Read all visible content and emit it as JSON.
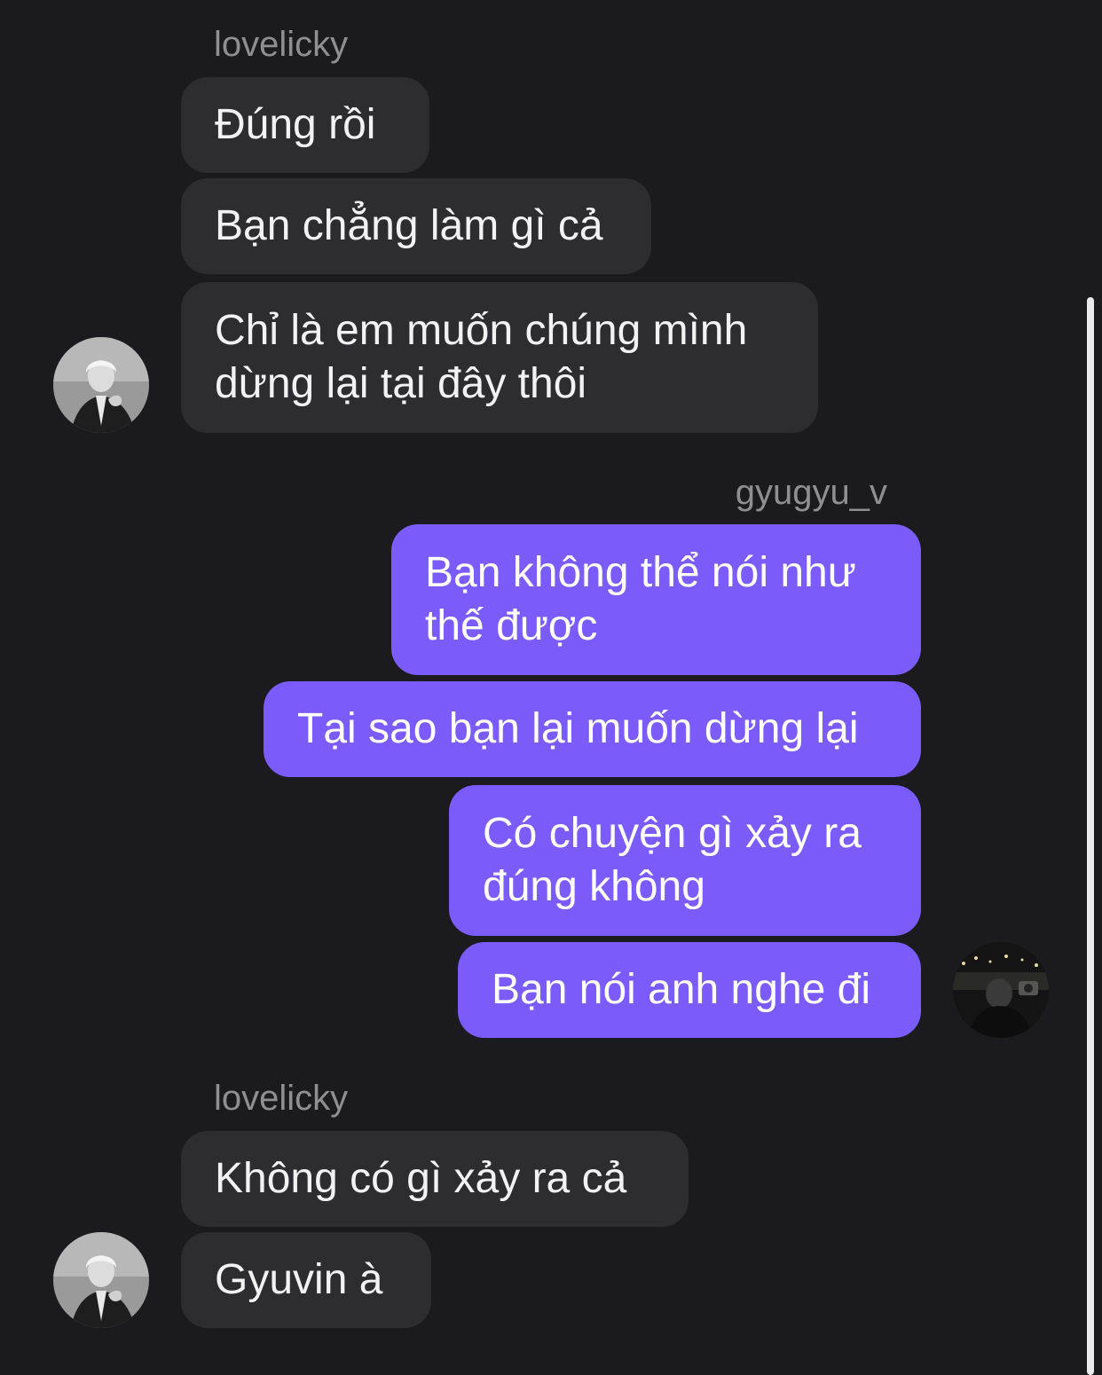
{
  "thread": {
    "group1": {
      "sender": "lovelicky",
      "messages": [
        "Đúng rồi",
        "Bạn chẳng làm gì cả",
        [
          "Chỉ là em muốn chúng mình",
          "dừng lại tại đây thôi"
        ]
      ]
    },
    "group2": {
      "sender": "gyugyu_v",
      "messages": [
        [
          "Bạn không thể nói như",
          "thế được"
        ],
        "Tại sao bạn lại muốn dừng lại",
        [
          "Có chuyện gì xảy ra",
          "đúng không"
        ],
        "Bạn nói anh nghe đi"
      ]
    },
    "group3": {
      "sender": "lovelicky",
      "messages": [
        "Không có gì xảy ra cả",
        "Gyuvin à"
      ]
    }
  },
  "colors": {
    "background": "#1b1b1f",
    "incoming_bubble": "#2c2c31",
    "outgoing_bubble": "#7b5cfa",
    "sender_name": "#8e8e93"
  }
}
